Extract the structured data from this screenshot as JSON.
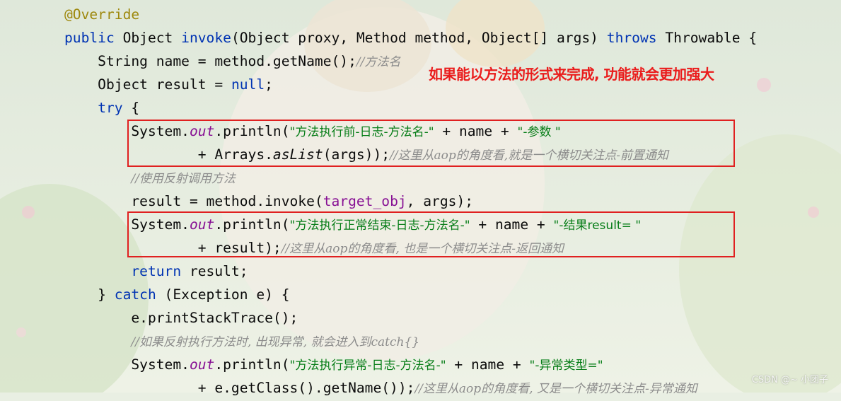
{
  "code_lines": [
    {
      "segments": [
        {
          "t": "@Override",
          "c": "ann"
        }
      ]
    },
    {
      "segments": [
        {
          "t": "public ",
          "c": "kw"
        },
        {
          "t": "Object "
        },
        {
          "t": "invoke",
          "c": "kw"
        },
        {
          "t": "(Object proxy, Method method, Object[] args) "
        },
        {
          "t": "throws",
          "c": "kw"
        },
        {
          "t": " Throwable {"
        }
      ]
    },
    {
      "segments": [
        {
          "t": "    String name = method.getName();"
        },
        {
          "t": "//方法名",
          "c": "cmt"
        }
      ]
    },
    {
      "segments": [
        {
          "t": "    Object result = "
        },
        {
          "t": "null",
          "c": "kw"
        },
        {
          "t": ";"
        }
      ]
    },
    {
      "segments": [
        {
          "t": "    "
        },
        {
          "t": "try",
          "c": "kw"
        },
        {
          "t": " {"
        }
      ]
    },
    {
      "segments": [
        {
          "t": "        System."
        },
        {
          "t": "out",
          "c": "fld"
        },
        {
          "t": ".println("
        },
        {
          "t": "\"方法执行前-日志-方法名-\"",
          "c": "str"
        },
        {
          "t": " + name + "
        },
        {
          "t": "\"-参数 \"",
          "c": "str"
        }
      ]
    },
    {
      "segments": [
        {
          "t": "                + Arrays."
        },
        {
          "t": "asList",
          "c": "st"
        },
        {
          "t": "(args));"
        },
        {
          "t": "//这里从aop的角度看,就是一个横切关注点-前置通知",
          "c": "cmt"
        }
      ]
    },
    {
      "segments": [
        {
          "t": "        "
        },
        {
          "t": "//使用反射调用方法",
          "c": "cmt"
        }
      ]
    },
    {
      "segments": [
        {
          "t": "        result = method.invoke("
        },
        {
          "t": "target_obj",
          "c": "fld2"
        },
        {
          "t": ", args);"
        }
      ]
    },
    {
      "segments": [
        {
          "t": "        System."
        },
        {
          "t": "out",
          "c": "fld"
        },
        {
          "t": ".println("
        },
        {
          "t": "\"方法执行正常结束-日志-方法名-\"",
          "c": "str"
        },
        {
          "t": " + name + "
        },
        {
          "t": "\"-结果result= \"",
          "c": "str"
        }
      ]
    },
    {
      "segments": [
        {
          "t": "                + result);"
        },
        {
          "t": "//这里从aop的角度看, 也是一个横切关注点-返回通知",
          "c": "cmt"
        }
      ]
    },
    {
      "segments": [
        {
          "t": "        "
        },
        {
          "t": "return",
          "c": "kw"
        },
        {
          "t": " result;"
        }
      ]
    },
    {
      "segments": [
        {
          "t": "    } "
        },
        {
          "t": "catch",
          "c": "kw"
        },
        {
          "t": " (Exception e) {"
        }
      ]
    },
    {
      "segments": [
        {
          "t": "        e.printStackTrace();"
        }
      ]
    },
    {
      "segments": [
        {
          "t": "        "
        },
        {
          "t": "//如果反射执行方法时, 出现异常, 就会进入到catch{}",
          "c": "cmt"
        }
      ]
    },
    {
      "segments": [
        {
          "t": "        System."
        },
        {
          "t": "out",
          "c": "fld"
        },
        {
          "t": ".println("
        },
        {
          "t": "\"方法执行异常-日志-方法名-\"",
          "c": "str"
        },
        {
          "t": " + name + "
        },
        {
          "t": "\"-异常类型=\"",
          "c": "str"
        }
      ]
    },
    {
      "segments": [
        {
          "t": "                + e.getClass().getName());"
        },
        {
          "t": "//这里从aop的角度看, 又是一个横切关注点-异常通知",
          "c": "cmt"
        }
      ]
    }
  ],
  "annotation_note": "如果能以方法的形式来完成, 功能就会更加强大",
  "watermark": "CSDN @~ 小团子",
  "colors": {
    "keyword": "#0033b3",
    "string": "#067d17",
    "comment": "#8c8c8c",
    "annotation": "#9e880d",
    "field": "#871094",
    "highlight_box": "#e02020",
    "note": "#ea1c1c"
  }
}
